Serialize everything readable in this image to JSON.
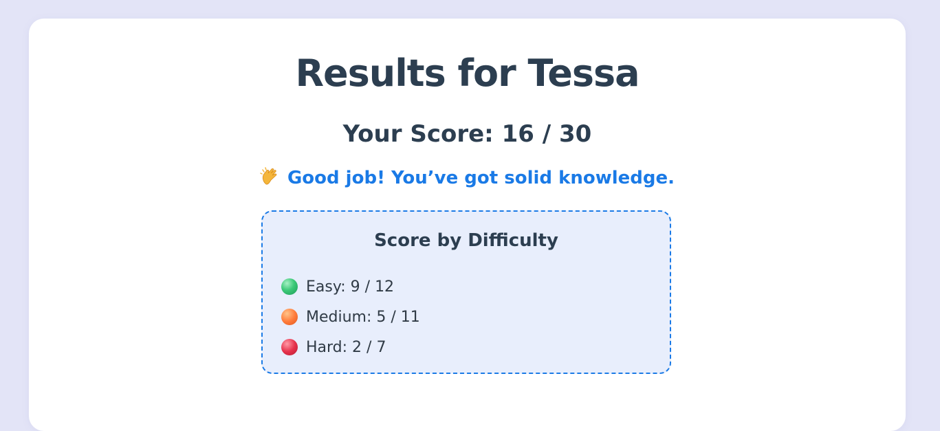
{
  "results": {
    "title": "Results for Tessa",
    "score_text": "Your Score: 16 / 30",
    "message_icon": "clapping-hands-icon",
    "message": "Good job! You’ve got solid knowledge."
  },
  "breakdown": {
    "title": "Score by Difficulty",
    "items": [
      {
        "icon": "green-circle-icon",
        "label": "Easy: 9 / 12"
      },
      {
        "icon": "orange-circle-icon",
        "label": "Medium: 5 / 11"
      },
      {
        "icon": "red-circle-icon",
        "label": "Hard: 2 / 7"
      }
    ]
  },
  "colors": {
    "background": "#e3e4f7",
    "card": "#ffffff",
    "heading": "#2c3e50",
    "accent": "#1a7ae6",
    "panel": "#e8eefc"
  }
}
